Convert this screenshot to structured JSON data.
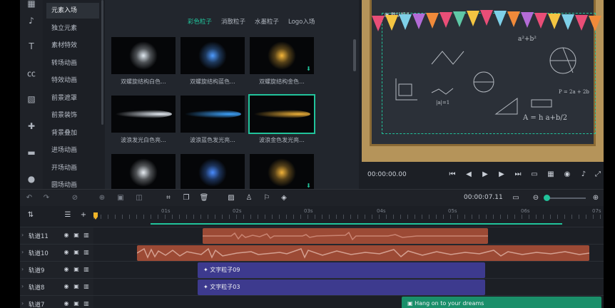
{
  "sidebar": {
    "categories": [
      "元素入场",
      "独立元素",
      "素材特效",
      "转场动画",
      "特效动画",
      "前景遮罩",
      "前景装饰",
      "背景叠加",
      "进场动画",
      "开场动画",
      "圆场动画"
    ]
  },
  "media": {
    "subtabs": [
      "彩色粒子",
      "消散粒子",
      "水墨粒子",
      "Logo入场"
    ],
    "items": [
      {
        "label": "双螺旋结构白色...",
        "color": "#dfe8f0"
      },
      {
        "label": "双螺旋结构蓝色...",
        "color": "#4f9bff"
      },
      {
        "label": "双螺旋结构金色...",
        "color": "#f5b73a"
      },
      {
        "label": "波浪发光白色亮...",
        "color": "#e8eef6"
      },
      {
        "label": "波浪蓝色发光亮...",
        "color": "#3fa5ff"
      },
      {
        "label": "波浪金色发光亮...",
        "color": "#f0b23a"
      },
      {
        "label": "",
        "color": "#e6ecf2"
      },
      {
        "label": "",
        "color": "#4a8cff"
      },
      {
        "label": "",
        "color": "#f0b23a"
      }
    ]
  },
  "preview": {
    "layer_label": "默认标头",
    "time": "00:00:00.00",
    "formula_1": "A = h a+b/2",
    "formula_2": "P = 2a + 2b",
    "formula_3": "a²+b²",
    "formula_4": "|a|=1"
  },
  "toolbar": {
    "timecode": "00:00:07.11"
  },
  "timeline": {
    "ruler": [
      "01s",
      "02s",
      "03s",
      "04s",
      "05s",
      "06s",
      "07s"
    ],
    "tracks": [
      {
        "name": "轨道11",
        "clip": ""
      },
      {
        "name": "轨道10",
        "clip": ""
      },
      {
        "name": "轨道9",
        "clip": "文字粒子09"
      },
      {
        "name": "轨道8",
        "clip": "文字粒子03"
      },
      {
        "name": "轨道7",
        "clip": "Hang on to your dreams"
      }
    ]
  },
  "colors": {
    "accent": "#21c39b",
    "audio_clip": "#9c4a35",
    "text_clip": "#3d3a8e",
    "playhead": "#f0b428"
  }
}
